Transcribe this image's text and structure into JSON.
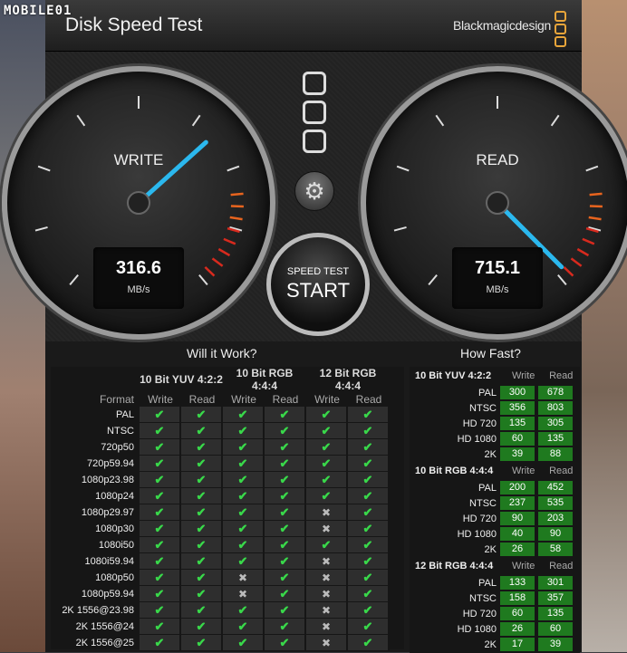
{
  "watermark": "MOBILE01",
  "window": {
    "title": "Disk Speed Test",
    "brand": "Blackmagicdesign"
  },
  "gauges": [
    {
      "label": "WRITE",
      "value": "316.6",
      "unit": "MB/s"
    },
    {
      "label": "READ",
      "value": "715.1",
      "unit": "MB/s"
    }
  ],
  "controls": {
    "settings_icon": "gear-icon",
    "start_small": "SPEED TEST",
    "start_big": "START"
  },
  "will_it_work": {
    "title": "Will it Work?",
    "format_label": "Format",
    "groups": [
      "10 Bit YUV 4:2:2",
      "10 Bit RGB 4:4:4",
      "12 Bit RGB 4:4:4"
    ],
    "write_label": "Write",
    "read_label": "Read",
    "rows": [
      {
        "format": "PAL",
        "cells": [
          1,
          1,
          1,
          1,
          1,
          1
        ]
      },
      {
        "format": "NTSC",
        "cells": [
          1,
          1,
          1,
          1,
          1,
          1
        ]
      },
      {
        "format": "720p50",
        "cells": [
          1,
          1,
          1,
          1,
          1,
          1
        ]
      },
      {
        "format": "720p59.94",
        "cells": [
          1,
          1,
          1,
          1,
          1,
          1
        ]
      },
      {
        "format": "1080p23.98",
        "cells": [
          1,
          1,
          1,
          1,
          1,
          1
        ]
      },
      {
        "format": "1080p24",
        "cells": [
          1,
          1,
          1,
          1,
          1,
          1
        ]
      },
      {
        "format": "1080p29.97",
        "cells": [
          1,
          1,
          1,
          1,
          0,
          1
        ]
      },
      {
        "format": "1080p30",
        "cells": [
          1,
          1,
          1,
          1,
          0,
          1
        ]
      },
      {
        "format": "1080i50",
        "cells": [
          1,
          1,
          1,
          1,
          1,
          1
        ]
      },
      {
        "format": "1080i59.94",
        "cells": [
          1,
          1,
          1,
          1,
          0,
          1
        ]
      },
      {
        "format": "1080p50",
        "cells": [
          1,
          1,
          0,
          1,
          0,
          1
        ]
      },
      {
        "format": "1080p59.94",
        "cells": [
          1,
          1,
          0,
          1,
          0,
          1
        ]
      },
      {
        "format": "2K 1556@23.98",
        "cells": [
          1,
          1,
          1,
          1,
          0,
          1
        ]
      },
      {
        "format": "2K 1556@24",
        "cells": [
          1,
          1,
          1,
          1,
          0,
          1
        ]
      },
      {
        "format": "2K 1556@25",
        "cells": [
          1,
          1,
          1,
          1,
          0,
          1
        ]
      }
    ]
  },
  "how_fast": {
    "title": "How Fast?",
    "write_label": "Write",
    "read_label": "Read",
    "groups": [
      {
        "name": "10 Bit YUV 4:2:2",
        "rows": [
          {
            "format": "PAL",
            "write": "300",
            "read": "678"
          },
          {
            "format": "NTSC",
            "write": "356",
            "read": "803"
          },
          {
            "format": "HD 720",
            "write": "135",
            "read": "305"
          },
          {
            "format": "HD 1080",
            "write": "60",
            "read": "135"
          },
          {
            "format": "2K",
            "write": "39",
            "read": "88"
          }
        ]
      },
      {
        "name": "10 Bit RGB 4:4:4",
        "rows": [
          {
            "format": "PAL",
            "write": "200",
            "read": "452"
          },
          {
            "format": "NTSC",
            "write": "237",
            "read": "535"
          },
          {
            "format": "HD 720",
            "write": "90",
            "read": "203"
          },
          {
            "format": "HD 1080",
            "write": "40",
            "read": "90"
          },
          {
            "format": "2K",
            "write": "26",
            "read": "58"
          }
        ]
      },
      {
        "name": "12 Bit RGB 4:4:4",
        "rows": [
          {
            "format": "PAL",
            "write": "133",
            "read": "301"
          },
          {
            "format": "NTSC",
            "write": "158",
            "read": "357"
          },
          {
            "format": "HD 720",
            "write": "60",
            "read": "135"
          },
          {
            "format": "HD 1080",
            "write": "26",
            "read": "60"
          },
          {
            "format": "2K",
            "write": "17",
            "read": "39"
          }
        ]
      }
    ]
  }
}
